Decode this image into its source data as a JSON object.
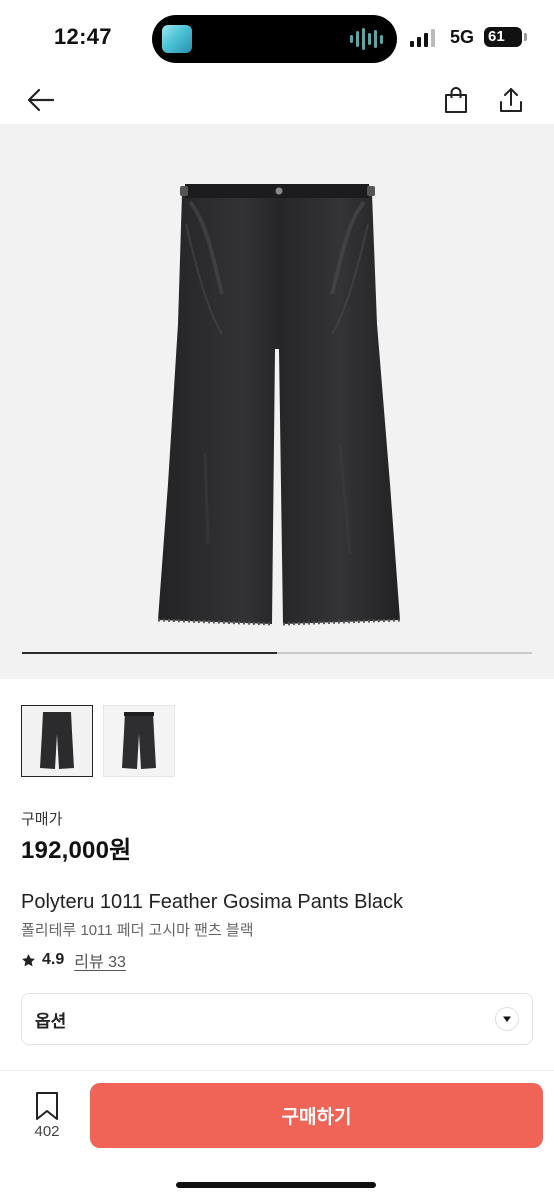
{
  "status_bar": {
    "time": "12:47",
    "network": "5G",
    "battery": "61"
  },
  "nav": {
    "back_icon": "arrow-left-icon",
    "cart_icon": "shopping-bag-icon",
    "share_icon": "share-icon"
  },
  "gallery": {
    "progress": 0.5,
    "slide_count": 2,
    "active_index": 0
  },
  "product": {
    "price_label": "구매가",
    "price": "192,000원",
    "name_en": "Polyteru 1011 Feather Gosima Pants Black",
    "name_ko": "폴리테루 1011 페더 고시마 팬츠 블랙",
    "rating": "4.9",
    "review_text": "리뷰 33"
  },
  "option": {
    "label": "옵션"
  },
  "bottom": {
    "wish_count": "402",
    "buy_label": "구매하기"
  },
  "colors": {
    "buy_button": "#ef6457",
    "pants": "#2b2b2d",
    "hero_background": "#f2f2f2"
  }
}
